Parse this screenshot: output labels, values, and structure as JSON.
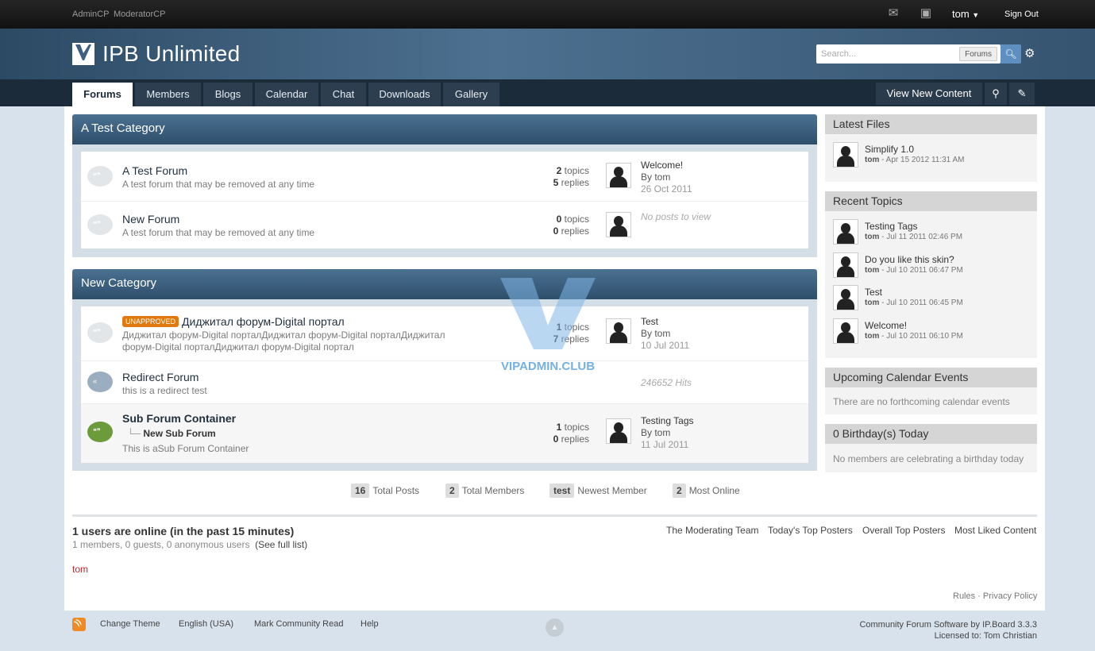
{
  "topbar": {
    "links": [
      "AdminCP",
      "ModeratorCP"
    ],
    "user": "tom",
    "signout": "Sign Out"
  },
  "header": {
    "site_title": "IPB Unlimited",
    "search_placeholder": "Search...",
    "search_scope": "Forums"
  },
  "nav": {
    "tabs": [
      "Forums",
      "Members",
      "Blogs",
      "Calendar",
      "Chat",
      "Downloads",
      "Gallery"
    ],
    "view_new": "View New Content"
  },
  "categories": [
    {
      "title": "A Test Category",
      "forums": [
        {
          "name": "A Test Forum",
          "desc": "A test forum that may be removed at any time",
          "topics": "2",
          "replies": "5",
          "last_title": "Welcome!",
          "last_by": "By tom",
          "last_date": "26 Oct 2011"
        },
        {
          "name": "New Forum",
          "desc": "A test forum that may be removed at any time",
          "topics": "0",
          "replies": "0",
          "no_posts": "No posts to view"
        }
      ]
    },
    {
      "title": "New Category",
      "forums": [
        {
          "badge": "UNAPPROVED",
          "name": "Диджитал форум-Digital портал",
          "desc1": "Диджитал форум-Digital порталДиджитал форум-Digital порталДиджитал",
          "desc2": "форум-Digital порталДиджитал форум-Digital портал",
          "topics": "1",
          "replies": "7",
          "last_title": "Test",
          "last_by": "By tom",
          "last_date": "10 Jul 2011"
        },
        {
          "name": "Redirect Forum",
          "desc": "this is a redirect test",
          "hits": "246652 Hits"
        },
        {
          "name": "Sub Forum Container",
          "sub": "New Sub Forum",
          "desc": "This is aSub Forum Container",
          "topics": "1",
          "replies": "0",
          "last_title": "Testing Tags",
          "last_by": "By tom",
          "last_date": "11 Jul 2011"
        }
      ]
    }
  ],
  "labels": {
    "topics": "topics",
    "replies": "replies"
  },
  "sidebar": {
    "latest_files": {
      "title": "Latest Files",
      "items": [
        {
          "t": "Simplify 1.0",
          "u": "tom",
          "d": " - Apr 15 2012 11:31 AM"
        }
      ]
    },
    "recent_topics": {
      "title": "Recent Topics",
      "items": [
        {
          "t": "Testing Tags",
          "u": "tom",
          "d": " - Jul 11 2011 02:46 PM"
        },
        {
          "t": "Do you like this skin?",
          "u": "tom",
          "d": " - Jul 10 2011 06:47 PM"
        },
        {
          "t": "Test",
          "u": "tom",
          "d": " - Jul 10 2011 06:45 PM"
        },
        {
          "t": "Welcome!",
          "u": "tom",
          "d": " - Jul 10 2011 06:10 PM"
        }
      ]
    },
    "calendar": {
      "title": "Upcoming Calendar Events",
      "note": "There are no forthcoming calendar events"
    },
    "birthdays": {
      "title": "0 Birthday(s) Today",
      "note": "No members are celebrating a birthday today"
    }
  },
  "stats": [
    {
      "n": "16",
      "l": "Total Posts"
    },
    {
      "n": "2",
      "l": "Total Members"
    },
    {
      "n": "test",
      "l": "Newest Member"
    },
    {
      "n": "2",
      "l": "Most Online"
    }
  ],
  "online": {
    "title": "1 users are online (in the past 15 minutes)",
    "detail": "1 members, 0 guests, 0 anonymous users",
    "full_list": "(See full list)",
    "users": [
      "tom"
    ],
    "links": [
      "The Moderating Team",
      "Today's Top Posters",
      "Overall Top Posters",
      "Most Liked Content"
    ]
  },
  "rules": "Rules · Privacy Policy",
  "footer": {
    "links": [
      "Change Theme",
      "English (USA)",
      "Mark Community Read",
      "Help"
    ],
    "credit1": "Community Forum Software by IP.Board 3.3.3",
    "credit2": "Licensed to: Tom Christian"
  },
  "watermark": "VIPADMIN.CLUB",
  "colors": {
    "accent": "#3e6080",
    "nav": "#1c2b39",
    "badge": "#e07a10",
    "online_user": "#c0282d"
  }
}
